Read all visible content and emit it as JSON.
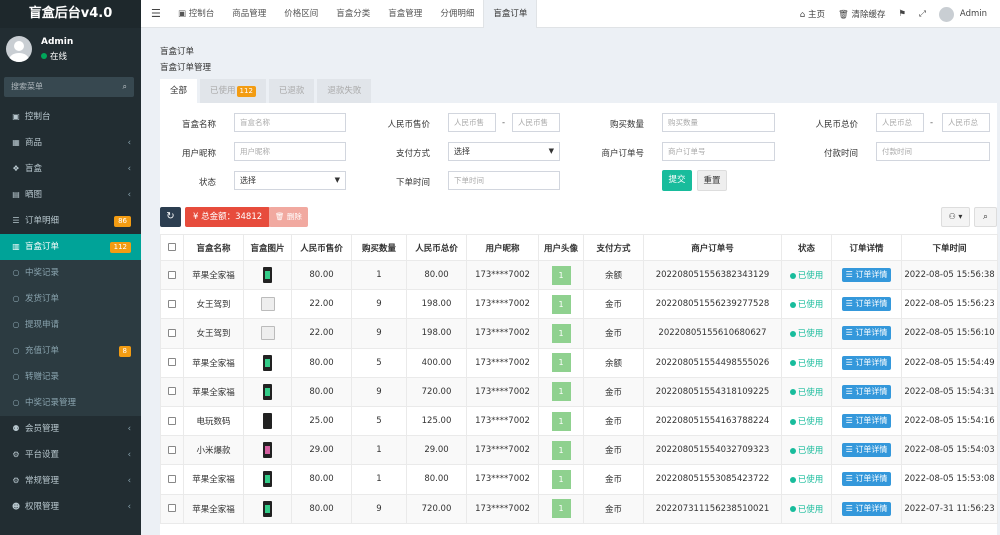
{
  "app": {
    "title": "盲盒后台v4.0"
  },
  "user": {
    "name": "Admin",
    "status": "在线"
  },
  "sidebar": {
    "search_placeholder": "搜索菜单",
    "items": [
      {
        "icon": "dashboard-icon",
        "label": "控制台",
        "chevron": false,
        "badge": "",
        "badge_color": "",
        "active": false,
        "sub": false
      },
      {
        "icon": "cube-icon",
        "label": "商品",
        "chevron": true,
        "badge": "",
        "badge_color": "",
        "active": false,
        "sub": false
      },
      {
        "icon": "gift-icon",
        "label": "盲盒",
        "chevron": true,
        "badge": "",
        "badge_color": "",
        "active": false,
        "sub": false
      },
      {
        "icon": "image-icon",
        "label": "晒图",
        "chevron": true,
        "badge": "",
        "badge_color": "",
        "active": false,
        "sub": false
      },
      {
        "icon": "cart-icon",
        "label": "订单明细",
        "chevron": false,
        "badge": "86",
        "badge_color": "#f39c12",
        "active": false,
        "sub": false
      },
      {
        "icon": "calendar-icon",
        "label": "盲盒订单",
        "chevron": false,
        "badge": "112",
        "badge_color": "#f39c12",
        "active": true,
        "sub": false
      },
      {
        "icon": "circle-icon",
        "label": "中奖记录",
        "chevron": false,
        "badge": "",
        "badge_color": "",
        "active": false,
        "sub": true
      },
      {
        "icon": "circle-icon",
        "label": "发货订单",
        "chevron": false,
        "badge": "",
        "badge_color": "",
        "active": false,
        "sub": true
      },
      {
        "icon": "circle-icon",
        "label": "提现申请",
        "chevron": false,
        "badge": "",
        "badge_color": "",
        "active": false,
        "sub": true
      },
      {
        "icon": "circle-icon",
        "label": "充值订单",
        "chevron": false,
        "badge": "8",
        "badge_color": "#f39c12",
        "active": false,
        "sub": true
      },
      {
        "icon": "circle-icon",
        "label": "转赠记录",
        "chevron": false,
        "badge": "",
        "badge_color": "",
        "active": false,
        "sub": true
      },
      {
        "icon": "circle-icon",
        "label": "中奖记录管理",
        "chevron": false,
        "badge": "",
        "badge_color": "",
        "active": false,
        "sub": true
      },
      {
        "icon": "users-icon",
        "label": "会员管理",
        "chevron": true,
        "badge": "",
        "badge_color": "",
        "active": false,
        "sub": false
      },
      {
        "icon": "cog-icon",
        "label": "平台设置",
        "chevron": true,
        "badge": "",
        "badge_color": "",
        "active": false,
        "sub": false
      },
      {
        "icon": "cogs-icon",
        "label": "常规管理",
        "chevron": true,
        "badge": "",
        "badge_color": "",
        "active": false,
        "sub": false
      },
      {
        "icon": "group-icon",
        "label": "权限管理",
        "chevron": true,
        "badge": "",
        "badge_color": "",
        "active": false,
        "sub": false
      }
    ]
  },
  "topbar": {
    "tabs": [
      {
        "label": "控制台",
        "icon": "dashboard-icon",
        "active": false
      },
      {
        "label": "商品管理",
        "icon": "",
        "active": false
      },
      {
        "label": "价格区间",
        "icon": "",
        "active": false
      },
      {
        "label": "盲盒分类",
        "icon": "",
        "active": false
      },
      {
        "label": "盲盒管理",
        "icon": "",
        "active": false
      },
      {
        "label": "分佣明细",
        "icon": "",
        "active": false
      },
      {
        "label": "盲盒订单",
        "icon": "",
        "active": true
      }
    ],
    "home_label": "主页",
    "clear_cache_label": "清除缓存",
    "admin_label": "Admin"
  },
  "page": {
    "title": "盲盒订单",
    "subtitle": "盲盒订单管理"
  },
  "status_tabs": [
    {
      "label": "全部",
      "badge": "",
      "active": true
    },
    {
      "label": "已使用",
      "badge": "112",
      "active": false
    },
    {
      "label": "已退款",
      "badge": "",
      "active": false
    },
    {
      "label": "退款失败",
      "badge": "",
      "active": false
    }
  ],
  "filters": {
    "box_name": {
      "label": "盲盒名称",
      "placeholder": "盲盒名称"
    },
    "rmb_price": {
      "label": "人民币售价",
      "placeholder_from": "人民币售",
      "placeholder_to": "人民币售"
    },
    "buy_count": {
      "label": "购买数量",
      "placeholder": "购买数量"
    },
    "rmb_total": {
      "label": "人民币总价",
      "placeholder_from": "人民币总",
      "placeholder_to": "人民币总"
    },
    "nickname": {
      "label": "用户昵称",
      "placeholder": "用户昵称"
    },
    "pay_method": {
      "label": "支付方式",
      "value": "选择"
    },
    "merchant_no": {
      "label": "商户订单号",
      "placeholder": "商户订单号"
    },
    "pay_time": {
      "label": "付款时间",
      "placeholder": "付款时间"
    },
    "status": {
      "label": "状态",
      "value": "选择"
    },
    "order_time": {
      "label": "下单时间",
      "placeholder": "下单时间"
    },
    "submit_label": "提交",
    "reset_label": "重置"
  },
  "toolbar": {
    "total_label": "¥ 总金额：34812",
    "delete_label": "删除"
  },
  "table": {
    "columns": [
      "盲盒名称",
      "盲盒图片",
      "人民币售价",
      "购买数量",
      "人民币总价",
      "用户昵称",
      "用户头像",
      "支付方式",
      "商户订单号",
      "状态",
      "订单详情",
      "下单时间"
    ],
    "detail_label": "订单详情",
    "rows": [
      {
        "name": "苹果全家福",
        "img": "phone-green",
        "price": "80.00",
        "qty": "1",
        "total": "80.00",
        "nick": "173****7002",
        "avatar": "1",
        "pay": "余额",
        "order_no": "2022080515563823​43129",
        "status": "已使用",
        "time": "2022-08-05 15:56:38"
      },
      {
        "name": "女王驾到",
        "img": "bag",
        "price": "22.00",
        "qty": "9",
        "total": "198.00",
        "nick": "173****7002",
        "avatar": "1",
        "pay": "金币",
        "order_no": "20220805155623927​7528",
        "status": "已使用",
        "time": "2022-08-05 15:56:23"
      },
      {
        "name": "女王驾到",
        "img": "bag",
        "price": "22.00",
        "qty": "9",
        "total": "198.00",
        "nick": "173****7002",
        "avatar": "1",
        "pay": "金币",
        "order_no": "20220805155610​680627",
        "status": "已使用",
        "time": "2022-08-05 15:56:10"
      },
      {
        "name": "苹果全家福",
        "img": "phone-green",
        "price": "80.00",
        "qty": "5",
        "total": "400.00",
        "nick": "173****7002",
        "avatar": "1",
        "pay": "余额",
        "order_no": "20220805155449855​5026",
        "status": "已使用",
        "time": "2022-08-05 15:54:49"
      },
      {
        "name": "苹果全家福",
        "img": "phone-green",
        "price": "80.00",
        "qty": "9",
        "total": "720.00",
        "nick": "173****7002",
        "avatar": "1",
        "pay": "金币",
        "order_no": "20220805155431810​9225",
        "status": "已使用",
        "time": "2022-08-05 15:54:31"
      },
      {
        "name": "电玩数码",
        "img": "console",
        "price": "25.00",
        "qty": "5",
        "total": "125.00",
        "nick": "173****7002",
        "avatar": "1",
        "pay": "金币",
        "order_no": "20220805155416378​8224",
        "status": "已使用",
        "time": "2022-08-05 15:54:16"
      },
      {
        "name": "小米爆款",
        "img": "phone-pink",
        "price": "29.00",
        "qty": "1",
        "total": "29.00",
        "nick": "173****7002",
        "avatar": "1",
        "pay": "金币",
        "order_no": "20220805155403270​9323",
        "status": "已使用",
        "time": "2022-08-05 15:54:03"
      },
      {
        "name": "苹果全家福",
        "img": "phone-green",
        "price": "80.00",
        "qty": "1",
        "total": "80.00",
        "nick": "173****7002",
        "avatar": "1",
        "pay": "金币",
        "order_no": "20220805155308542​3722",
        "status": "已使用",
        "time": "2022-08-05 15:53:08"
      },
      {
        "name": "苹果全家福",
        "img": "phone-green",
        "price": "80.00",
        "qty": "9",
        "total": "720.00",
        "nick": "173****7002",
        "avatar": "1",
        "pay": "金币",
        "order_no": "20220731115623851​0021",
        "status": "已使用",
        "time": "2022-07-31 11:56:23"
      }
    ]
  }
}
